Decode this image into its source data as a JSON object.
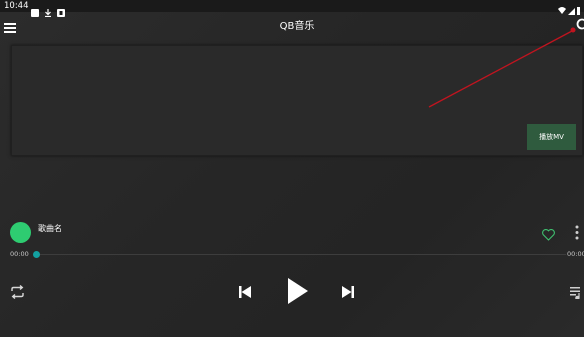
{
  "status_bar": {
    "time": "10:44",
    "icons_left": [
      "square-icon",
      "download-icon",
      "notification-icon"
    ],
    "icons_right": [
      "wifi-icon",
      "signal-icon",
      "battery-icon"
    ]
  },
  "app_bar": {
    "title": "QB音乐",
    "left_icon": "menu-icon",
    "right_icon": "search-icon"
  },
  "video": {
    "play_mv_label": "播放MV"
  },
  "song": {
    "name": "歌曲名",
    "avatar_color": "#2ecc71",
    "favorite_icon": "heart-outline-icon",
    "more_icon": "more-vertical-icon"
  },
  "progress": {
    "current_time": "00:00",
    "total_time": "00:00",
    "fraction": 0
  },
  "controls": {
    "repeat_icon": "repeat-icon",
    "previous_icon": "skip-previous-icon",
    "play_icon": "play-icon",
    "next_icon": "skip-next-icon",
    "playlist_icon": "playlist-icon"
  },
  "colors": {
    "accent_green": "#2f5b3e",
    "avatar_green": "#2ecc71",
    "progress_thumb": "#13a1a1",
    "annotation_red": "#c0141f"
  }
}
